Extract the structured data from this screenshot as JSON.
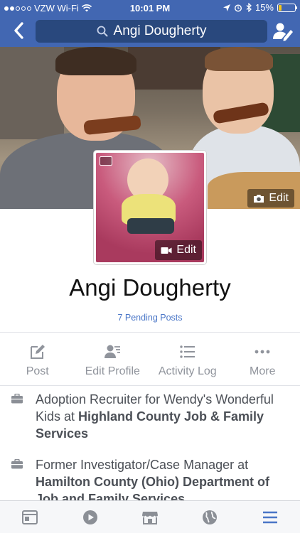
{
  "status_bar": {
    "carrier": "VZW Wi-Fi",
    "time": "10:01 PM",
    "battery": "15%",
    "battery_level": 0.15
  },
  "nav": {
    "search_query": "Angi Dougherty"
  },
  "profile": {
    "cover_edit_label": "Edit",
    "avatar_edit_label": "Edit",
    "name": "Angi Dougherty",
    "pending_posts": "7 Pending Posts"
  },
  "actions": [
    {
      "label": "Post",
      "icon": "compose-icon"
    },
    {
      "label": "Edit Profile",
      "icon": "profile-edit-icon"
    },
    {
      "label": "Activity Log",
      "icon": "list-icon"
    },
    {
      "label": "More",
      "icon": "more-dots-icon"
    }
  ],
  "intro": [
    {
      "icon": "briefcase-icon",
      "prefix": "Adoption Recruiter for Wendy's Wonderful Kids at ",
      "org": "Highland County Job & Family Services"
    },
    {
      "icon": "briefcase-icon",
      "prefix": "Former Investigator/Case Manager at ",
      "org": "Hamilton County (Ohio) Department of Job and Family Services"
    }
  ],
  "tabbar": [
    {
      "icon": "news-feed-icon",
      "active": false
    },
    {
      "icon": "video-play-icon",
      "active": false
    },
    {
      "icon": "marketplace-icon",
      "active": false
    },
    {
      "icon": "globe-icon",
      "active": false
    },
    {
      "icon": "menu-icon",
      "active": true
    }
  ],
  "colors": {
    "brand_blue": "#4267b2",
    "search_blue": "#29487d",
    "link_blue": "#4a76c7",
    "active_tab": "#4a76c7",
    "inactive_icon": "#8b8f96"
  }
}
